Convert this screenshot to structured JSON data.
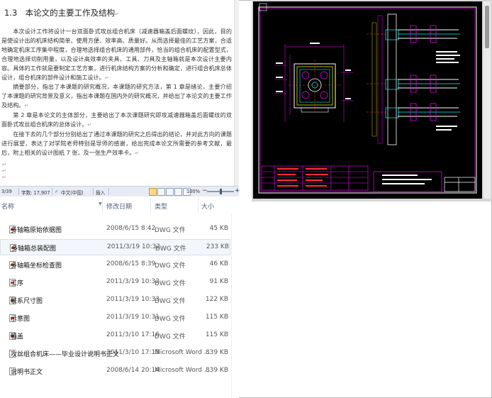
{
  "document": {
    "heading_number": "1.3",
    "heading_title": "本论文的主要工作及结构",
    "paragraphs": [
      "本次设计工作将设计一台双面卧式攻丝组合机床（减速器箱盖后面螺纹），因此，目的是使设计出的机床结构简单、使用方便、效率高、质量好。从而选择最佳的工艺方案，合适地确定机床工序集中程度，合理地选择组合机床的通用部件，恰当的组合机床的配置型式，合理地选择切削用量，以及设计高效率的夹具、工具、刀具及主轴箱就是本次设计主要内容。具体的工作就是要制定工艺方案，进行机床结构方案的分析和确定，进行组合机床总体设计，组合机床的部件设计和施工设计。",
      "摘要部分，指出了本课题的研究概况，本课题的研究方法，第 1 章是绪论，主要介绍了本课题的研究背景及意义，指出本课题在国内外的研究概况，并给出了本论文的主要工作及结构。",
      "第 2 章是本论文的主体部分，主要给出了本次课题研究即攻减速器箱盖后面螺纹的双面卧式攻丝组合机床的总体设计。",
      "在接下去的几个部分分别给出了通过本课题的研究之后得出的结论，并对此方向的课题进行展望，表达了对学院老师特别是导师的感谢，给出完成本论文所需要的参考文献，最后，附上相关的设计图纸 7 张，及一张生产效率卡。"
    ]
  },
  "statusbar": {
    "page": "3/39",
    "words": "字数: 17,907",
    "language": "中文(中国)",
    "mode": "插入",
    "zoom": "100%",
    "zoom_minus": "−",
    "zoom_plus": "+",
    "zoom_fraction": 0.5
  },
  "file_list": {
    "columns": {
      "name": "名称",
      "date": "修改日期",
      "type": "类型",
      "size": "大小"
    },
    "rows": [
      {
        "name": "多轴箱原始依据图",
        "date": "2008/6/15 8:42",
        "type": "DWG 文件",
        "size": "45 KB",
        "icon": "dwg-file-icon"
      },
      {
        "name": "多轴箱总装配图",
        "date": "2011/3/19 10:32",
        "type": "DWG 文件",
        "size": "233 KB",
        "icon": "dwg-file-icon"
      },
      {
        "name": "多轴箱坐标检查图",
        "date": "2008/6/15 8:39",
        "type": "DWG 文件",
        "size": "46 KB",
        "icon": "dwg-file-icon"
      },
      {
        "name": "工序",
        "date": "2011/3/19 10:32",
        "type": "DWG 文件",
        "size": "91 KB",
        "icon": "dwg-file-icon"
      },
      {
        "name": "联系尺寸图",
        "date": "2011/3/19 10:33",
        "type": "DWG 文件",
        "size": "122 KB",
        "icon": "dwg-file-icon"
      },
      {
        "name": "示意图",
        "date": "2011/3/19 10:31",
        "type": "DWG 文件",
        "size": "115 KB",
        "icon": "dwg-file-icon"
      },
      {
        "name": "箱盖",
        "date": "2011/3/10 17:16",
        "type": "DWG 文件",
        "size": "115 KB",
        "icon": "dwg-file-icon"
      },
      {
        "name": "攻丝组合机床——毕业设计说明书正文",
        "date": "2011/3/10 17:15",
        "type": "Microsoft Word ...",
        "size": "839 KB",
        "icon": "word-file-icon"
      },
      {
        "name": "说明书正文",
        "date": "2008/6/14 20:14",
        "type": "Microsoft Word ...",
        "size": "839 KB",
        "icon": "word-file-icon"
      }
    ]
  },
  "colors": {
    "cad_background": "#000000",
    "cad_magenta": "#ff00ff",
    "cad_cyan": "#00ffff",
    "cad_yellow": "#ffff00",
    "cad_white": "#ffffff",
    "cad_red": "#ff3030"
  }
}
